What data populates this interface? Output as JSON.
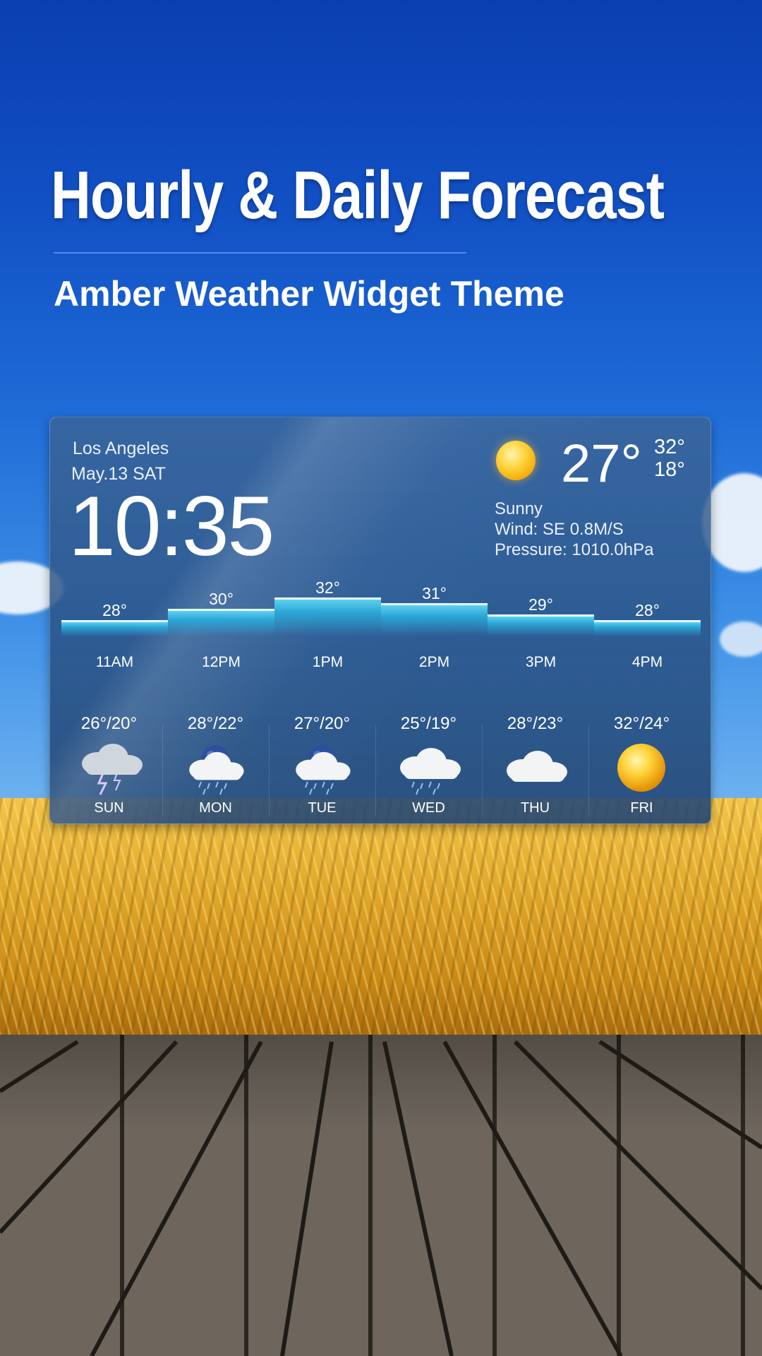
{
  "promo": {
    "headline": "Hourly & Daily Forecast",
    "subtitle": "Amber Weather Widget Theme"
  },
  "widget": {
    "city": "Los Angeles",
    "date": "May.13 SAT",
    "time": "10:35",
    "current_icon": "sun-icon",
    "current_temp": "27°",
    "high": "32°",
    "low": "18°",
    "condition": "Sunny",
    "wind": "Wind: SE 0.8M/S",
    "pressure": "Pressure: 1010.0hPa",
    "hourly": [
      {
        "time": "11AM",
        "temp": "28°",
        "value": 28
      },
      {
        "time": "12PM",
        "temp": "30°",
        "value": 30
      },
      {
        "time": "1PM",
        "temp": "32°",
        "value": 32
      },
      {
        "time": "2PM",
        "temp": "31°",
        "value": 31
      },
      {
        "time": "3PM",
        "temp": "29°",
        "value": 29
      },
      {
        "time": "4PM",
        "temp": "28°",
        "value": 28
      }
    ],
    "daily": [
      {
        "day": "SUN",
        "range": "26°/20°",
        "icon": "thunderstorm-icon"
      },
      {
        "day": "MON",
        "range": "28°/22°",
        "icon": "night-rain-icon"
      },
      {
        "day": "TUE",
        "range": "27°/20°",
        "icon": "night-rain-icon"
      },
      {
        "day": "WED",
        "range": "25°/19°",
        "icon": "light-rain-icon"
      },
      {
        "day": "THU",
        "range": "28°/23°",
        "icon": "cloudy-icon"
      },
      {
        "day": "FRI",
        "range": "32°/24°",
        "icon": "sun-icon"
      }
    ]
  },
  "colors": {
    "sky_top": "#0a3fb0",
    "bar_fill": "#2aa6d6",
    "bar_edge": "#e6fbff",
    "sun": "#ffd23a"
  }
}
